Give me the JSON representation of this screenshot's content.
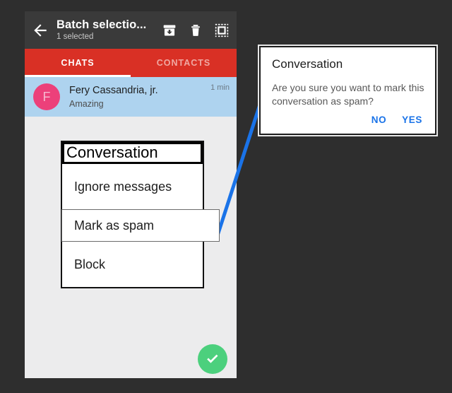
{
  "app_bar": {
    "back_icon": "back-arrow-icon",
    "title": "Batch selectio...",
    "subtitle": "1 selected",
    "actions": [
      {
        "name": "archive-icon",
        "label": "Archive"
      },
      {
        "name": "delete-icon",
        "label": "Delete"
      },
      {
        "name": "select-all-icon",
        "label": "Select all"
      }
    ]
  },
  "tabs": [
    {
      "label": "CHATS",
      "active": true
    },
    {
      "label": "CONTACTS",
      "active": false
    }
  ],
  "chat_list": [
    {
      "avatar_initial": "F",
      "name": "Fery Cassandria, jr.",
      "snippet": "Amazing",
      "time": "1 min",
      "selected": true
    }
  ],
  "fab": {
    "icon": "check-icon",
    "label": "Confirm"
  },
  "menu_dialog": {
    "title": "Conversation",
    "items": [
      {
        "label": "Ignore messages",
        "highlighted": false
      },
      {
        "label": "Mark as spam",
        "highlighted": true
      },
      {
        "label": "Block",
        "highlighted": false
      }
    ]
  },
  "callout_dialog": {
    "title": "Conversation",
    "message": "Are you sure you want to mark this conversation as spam?",
    "negative_label": "NO",
    "positive_label": "YES"
  },
  "colors": {
    "background": "#2e2e2e",
    "app_bar": "#3a3a3a",
    "accent_red": "#d93025",
    "selected_row": "#aed3ef",
    "avatar": "#ec407a",
    "fab_green": "#4cd07d",
    "link_blue": "#1a73e8",
    "connector_blue": "#1a73e8"
  }
}
